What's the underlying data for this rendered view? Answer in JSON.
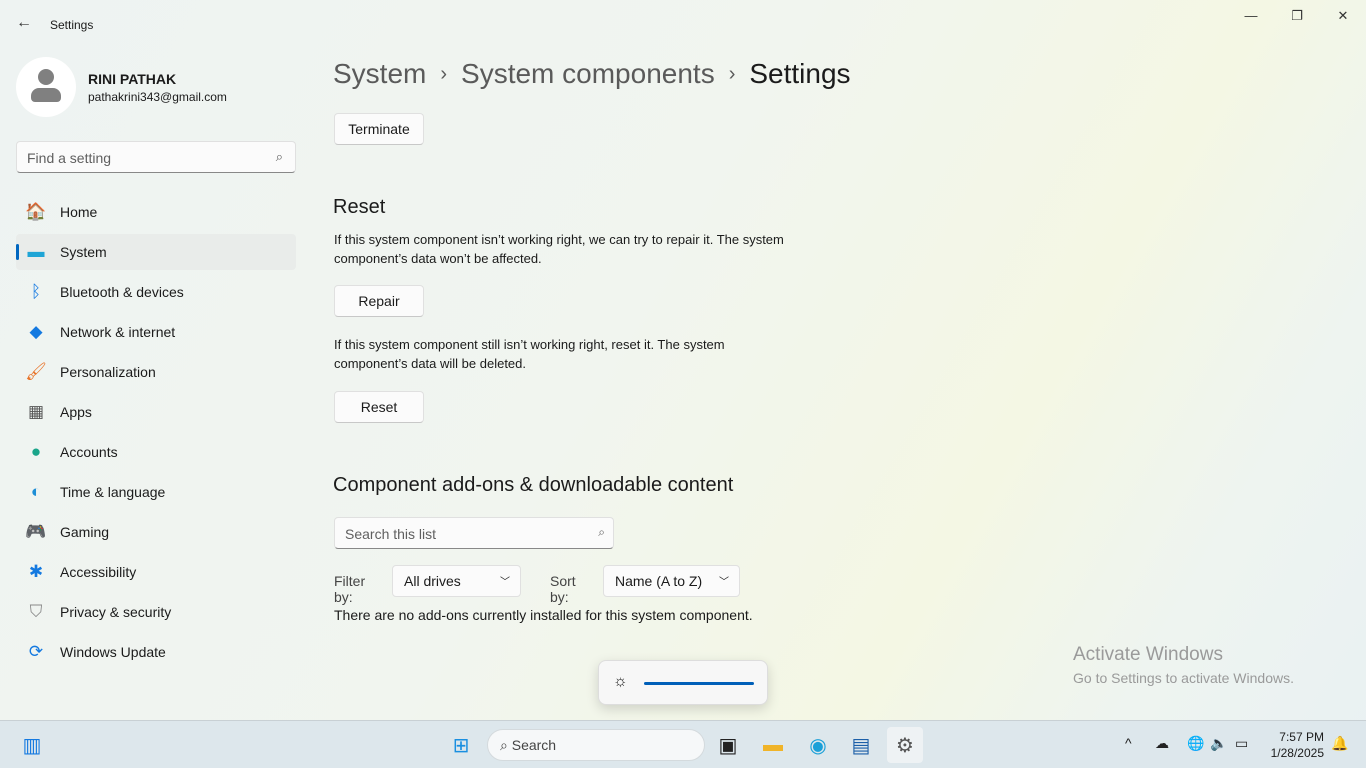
{
  "window": {
    "title": "Settings",
    "minimize": "—",
    "maximize": "❐",
    "close": "✕"
  },
  "profile": {
    "name": "RINI PATHAK",
    "email": "pathakrini343@gmail.com"
  },
  "find": {
    "placeholder": "Find a setting"
  },
  "nav": [
    {
      "label": "Home",
      "icon": "🏠",
      "color": "#e8742a"
    },
    {
      "label": "System",
      "icon": "▬",
      "color": "#1fa5d6"
    },
    {
      "label": "Bluetooth & devices",
      "icon": "ᛒ",
      "color": "#1479e0"
    },
    {
      "label": "Network & internet",
      "icon": "◆",
      "color": "#1479e0"
    },
    {
      "label": "Personalization",
      "icon": "🖌",
      "color": "#e8742a"
    },
    {
      "label": "Apps",
      "icon": "▦",
      "color": "#555"
    },
    {
      "label": "Accounts",
      "icon": "●",
      "color": "#1aa58a"
    },
    {
      "label": "Time & language",
      "icon": "◐",
      "color": "#1d8ed6"
    },
    {
      "label": "Gaming",
      "icon": "🎮",
      "color": "#777"
    },
    {
      "label": "Accessibility",
      "icon": "✱",
      "color": "#1479e0"
    },
    {
      "label": "Privacy & security",
      "icon": "⛉",
      "color": "#888"
    },
    {
      "label": "Windows Update",
      "icon": "⟳",
      "color": "#1479e0"
    }
  ],
  "breadcrumb": [
    "System",
    "System components",
    "Settings"
  ],
  "breadcrumb_sep": "›",
  "terminate": "Terminate",
  "reset_section": {
    "title": "Reset",
    "repair_text": "If this system component isn’t working right, we can try to repair it. The system component’s data won’t be affected.",
    "repair": "Repair",
    "reset_text": "If this system component still isn’t working right, reset it. The system component’s data will be deleted.",
    "reset": "Reset"
  },
  "addons": {
    "title": "Component add-ons & downloadable content",
    "search_placeholder": "Search this list",
    "filter_label": "Filter by:",
    "filter_value": "All drives",
    "sort_label": "Sort by:",
    "sort_value": "Name (A to Z)",
    "empty": "There are no add-ons currently installed for this system component."
  },
  "brightness": {
    "level": 100
  },
  "watermark": {
    "line1": "Activate Windows",
    "line2": "Go to Settings to activate Windows."
  },
  "taskbar": {
    "search": "Search",
    "time": "7:57 PM",
    "date": "1/28/2025"
  }
}
